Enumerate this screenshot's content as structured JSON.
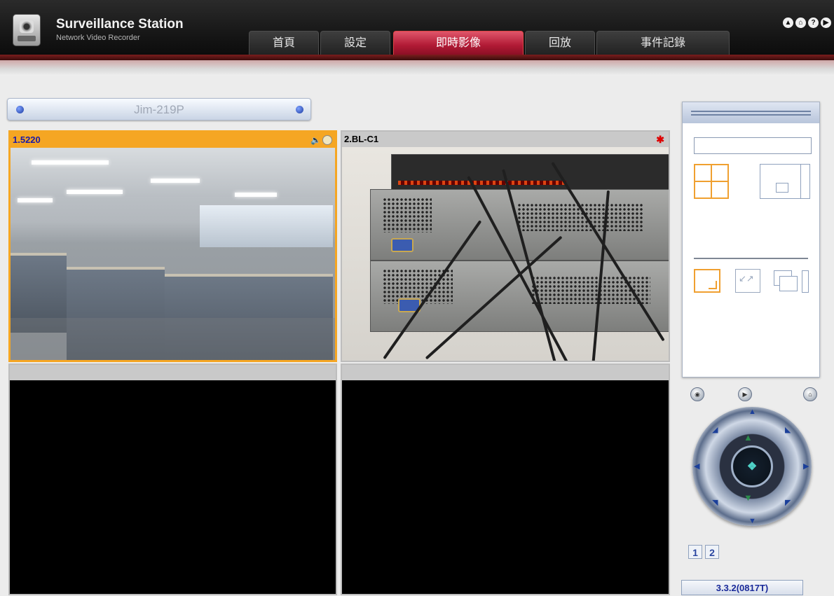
{
  "app": {
    "title": "Surveillance Station",
    "subtitle": "Network Video Recorder"
  },
  "nav": {
    "tabs": [
      {
        "label": "首頁",
        "active": false
      },
      {
        "label": "設定",
        "active": false
      },
      {
        "label": "即時影像",
        "active": true
      },
      {
        "label": "回放",
        "active": false
      },
      {
        "label": "事件記錄",
        "active": false
      }
    ]
  },
  "top_icons": [
    "eject-icon",
    "home-icon",
    "help-icon",
    "logout-icon"
  ],
  "group": {
    "name": "Jim-219P"
  },
  "cameras": [
    {
      "name": "1.5220",
      "selected": true
    },
    {
      "name": "2.BL-C1",
      "selected": false
    },
    {
      "name": "",
      "selected": false
    },
    {
      "name": "",
      "selected": false
    }
  ],
  "colors": {
    "accent": "#f5a623",
    "active_tab": "#b11a35",
    "header_bg": "#171717",
    "panel_border": "#8fa1bd"
  },
  "pages": [
    "1",
    "2"
  ],
  "version": "3.3.2(0817T)"
}
